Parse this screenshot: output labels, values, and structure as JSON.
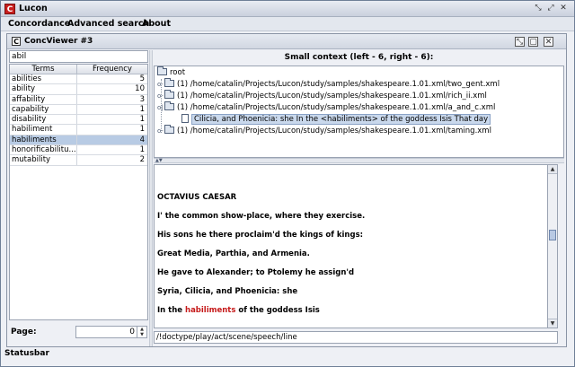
{
  "app": {
    "title": "Lucon"
  },
  "menu": [
    "Concordance",
    "Advanced search",
    "About"
  ],
  "internal_frame": {
    "title": "ConcViewer #3"
  },
  "left_panel": {
    "search_value": "abil",
    "columns": [
      "Terms",
      "Frequency"
    ],
    "rows": [
      {
        "term": "abilities",
        "freq": "5"
      },
      {
        "term": "ability",
        "freq": "10"
      },
      {
        "term": "affability",
        "freq": "3"
      },
      {
        "term": "capability",
        "freq": "1"
      },
      {
        "term": "disability",
        "freq": "1"
      },
      {
        "term": "habiliment",
        "freq": "1"
      },
      {
        "term": "habiliments",
        "freq": "4",
        "selected": true
      },
      {
        "term": "honorificabilitu...",
        "freq": "1"
      },
      {
        "term": "mutability",
        "freq": "2"
      }
    ],
    "page_label": "Page:",
    "page_value": "0"
  },
  "context": {
    "header": "Small context (left - 6, right - 6):",
    "tree": {
      "root": "root",
      "items": [
        {
          "label": "(1) /home/catalin/Projects/Lucon/study/samples/shakespeare.1.01.xml/two_gent.xml",
          "expanded": false
        },
        {
          "label": "(1) /home/catalin/Projects/Lucon/study/samples/shakespeare.1.01.xml/rich_ii.xml",
          "expanded": false
        },
        {
          "label": "(1) /home/catalin/Projects/Lucon/study/samples/shakespeare.1.01.xml/a_and_c.xml",
          "expanded": true
        },
        {
          "label": "Cilicia, and Phoenicia: she  In the <habiliments> of the goddess Isis  That day",
          "child": true,
          "selected": true
        },
        {
          "label": "(1) /home/catalin/Projects/Lucon/study/samples/shakespeare.1.01.xml/taming.xml",
          "expanded": false
        }
      ]
    },
    "text_lines": [
      "OCTAVIUS CAESAR",
      "I' the common show-place, where they exercise.",
      "His sons he there proclaim'd the kings of kings:",
      "Great Media, Parthia, and Armenia.",
      "He gave to Alexander; to Ptolemy he assign'd",
      "Syria, Cilicia, and Phoenicia: she"
    ],
    "highlight_line": {
      "before": "In the ",
      "keyword": "habiliments",
      "after": " of the goddess Isis"
    },
    "xpath": "/!doctype/play/act/scene/speech/line"
  },
  "statusbar": "Statusbar"
}
